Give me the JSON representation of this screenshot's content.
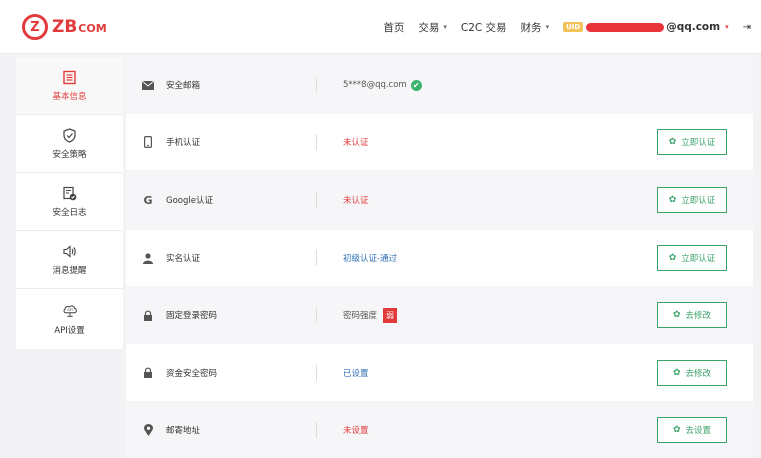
{
  "header": {
    "logo_mark": "Z",
    "logo_text": "ZB",
    "logo_suffix": "COM",
    "nav": [
      {
        "label": "首页",
        "caret": ""
      },
      {
        "label": "交易",
        "caret": "▾"
      },
      {
        "label": "C2C 交易",
        "caret": ""
      },
      {
        "label": "财务",
        "caret": "▾"
      }
    ],
    "uid_badge": "UID",
    "account_email": "@qq.com",
    "account_caret": "▾",
    "logout_icon": "⇥"
  },
  "sidebar": {
    "items": [
      {
        "label": "基本信息",
        "icon": "document-list-icon",
        "active": true
      },
      {
        "label": "安全策略",
        "icon": "shield-check-icon",
        "active": false
      },
      {
        "label": "安全日志",
        "icon": "log-check-icon",
        "active": false
      },
      {
        "label": "消息提醒",
        "icon": "speaker-icon",
        "active": false
      },
      {
        "label": "API设置",
        "icon": "api-cloud-icon",
        "active": false
      }
    ]
  },
  "rows": [
    {
      "label": "安全邮箱",
      "value": "5***8@qq.com",
      "verified": true,
      "button": ""
    },
    {
      "label": "手机认证",
      "value": "未认证",
      "button": "立即认证"
    },
    {
      "label": "Google认证",
      "value": "未认证",
      "button": "立即认证"
    },
    {
      "label": "实名认证",
      "value": "初级认证-通过",
      "button": "立即认证"
    },
    {
      "label": "固定登录密码",
      "value": "密码强度",
      "badge": "弱",
      "button": "去修改"
    },
    {
      "label": "资金安全密码",
      "value": "已设置",
      "button": "去修改"
    },
    {
      "label": "邮寄地址",
      "value": "未设置",
      "button": "去设置"
    }
  ],
  "check_glyph": "✔",
  "gear_glyph": "✿",
  "colors": {
    "brand": "#e23a3a",
    "action": "#3aa36a",
    "link": "#2f6fb5",
    "verified": "#3bb36a"
  }
}
